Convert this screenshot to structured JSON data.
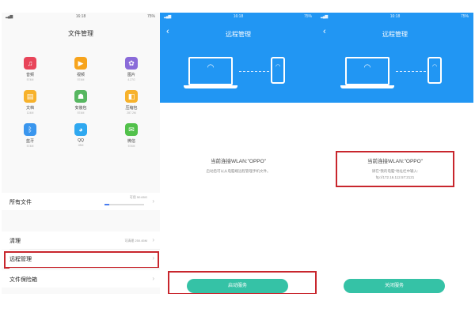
{
  "status": {
    "time": "16:18",
    "battery": "75%",
    "signal": "▂▄▆"
  },
  "screen1": {
    "title": "文件管理",
    "categories": [
      {
        "label": "音频",
        "size": "574M",
        "icon": "music-icon",
        "glyph": "♫",
        "color": "#e8455a"
      },
      {
        "label": "视频",
        "size": "574M",
        "icon": "video-icon",
        "glyph": "▶",
        "color": "#f7a41d"
      },
      {
        "label": "图片",
        "size": "4.27G",
        "icon": "image-icon",
        "glyph": "✿",
        "color": "#8a6bd9"
      },
      {
        "label": "文档",
        "size": "124M",
        "icon": "document-icon",
        "glyph": "▤",
        "color": "#f7b22c"
      },
      {
        "label": "安装包",
        "size": "574M",
        "icon": "android-icon",
        "glyph": "☗",
        "color": "#57b761"
      },
      {
        "label": "压缩包",
        "size": "287.2M",
        "icon": "archive-icon",
        "glyph": "◧",
        "color": "#f7b22c"
      },
      {
        "label": "蓝牙",
        "size": "574M",
        "icon": "bluetooth-icon",
        "glyph": "ᛒ",
        "color": "#3a96ee"
      },
      {
        "label": "QQ",
        "size": "28M",
        "icon": "qq-icon",
        "glyph": "◕",
        "color": "#2fa8f0"
      },
      {
        "label": "微信",
        "size": "574M",
        "icon": "wechat-icon",
        "glyph": "✉",
        "color": "#52c14b"
      }
    ],
    "all_files": {
      "label": "所有文件",
      "free": "可用 50.65G",
      "used_fraction": 0.12
    },
    "cleanup": {
      "label": "清理",
      "free": "可清理 250.45M"
    },
    "remote": {
      "label": "远程管理"
    },
    "safe": {
      "label": "文件保险箱"
    }
  },
  "screen2": {
    "title": "远程管理",
    "line1": "当前连接WLAN:\"OPPO\"",
    "line2": "启动后可以从电脑端远程管理手机文件。",
    "button": "启动服务"
  },
  "screen3": {
    "title": "远程管理",
    "line1": "当前连接WLAN:\"OPPO\"",
    "line2": "请在\"我的电脑\"地址栏中输入:",
    "line3": "ftp://172.16.112.57:2121",
    "button": "关闭服务"
  },
  "colors": {
    "blue": "#2196f3",
    "teal": "#35c2a6",
    "highlight": "#c8262d"
  }
}
